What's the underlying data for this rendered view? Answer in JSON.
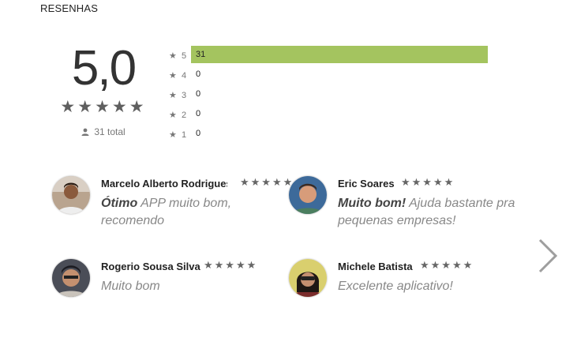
{
  "section_title": "RESENHAS",
  "summary": {
    "score": "5,0",
    "stars": "★★★★★",
    "total_label": "31 total"
  },
  "histogram": [
    {
      "star": "5",
      "count": "31",
      "fraction": 1.0
    },
    {
      "star": "4",
      "count": "0",
      "fraction": 0
    },
    {
      "star": "3",
      "count": "0",
      "fraction": 0
    },
    {
      "star": "2",
      "count": "0",
      "fraction": 0
    },
    {
      "star": "1",
      "count": "0",
      "fraction": 0
    }
  ],
  "reviews": [
    {
      "name": "Marcelo Alberto Rodrigues T",
      "stars": "★★★★★",
      "title": "Ótimo",
      "text": "APP muito bom, recomendo",
      "rating": 5
    },
    {
      "name": "Eric Soares",
      "stars": "★★★★★",
      "title": "Muito bom!",
      "text": "Ajuda bastante pra pequenas empresas!",
      "rating": 5
    },
    {
      "name": "Rogerio Sousa Silva",
      "stars": "★★★★★",
      "title": "",
      "text": "Muito bom",
      "rating": 5
    },
    {
      "name": "Michele Batista",
      "stars": "★★★★★",
      "title": "",
      "text": "Excelente aplicativo!",
      "rating": 5
    }
  ],
  "colors": {
    "bar": "#a4c45f",
    "star": "#666666",
    "text_muted": "#888888"
  }
}
